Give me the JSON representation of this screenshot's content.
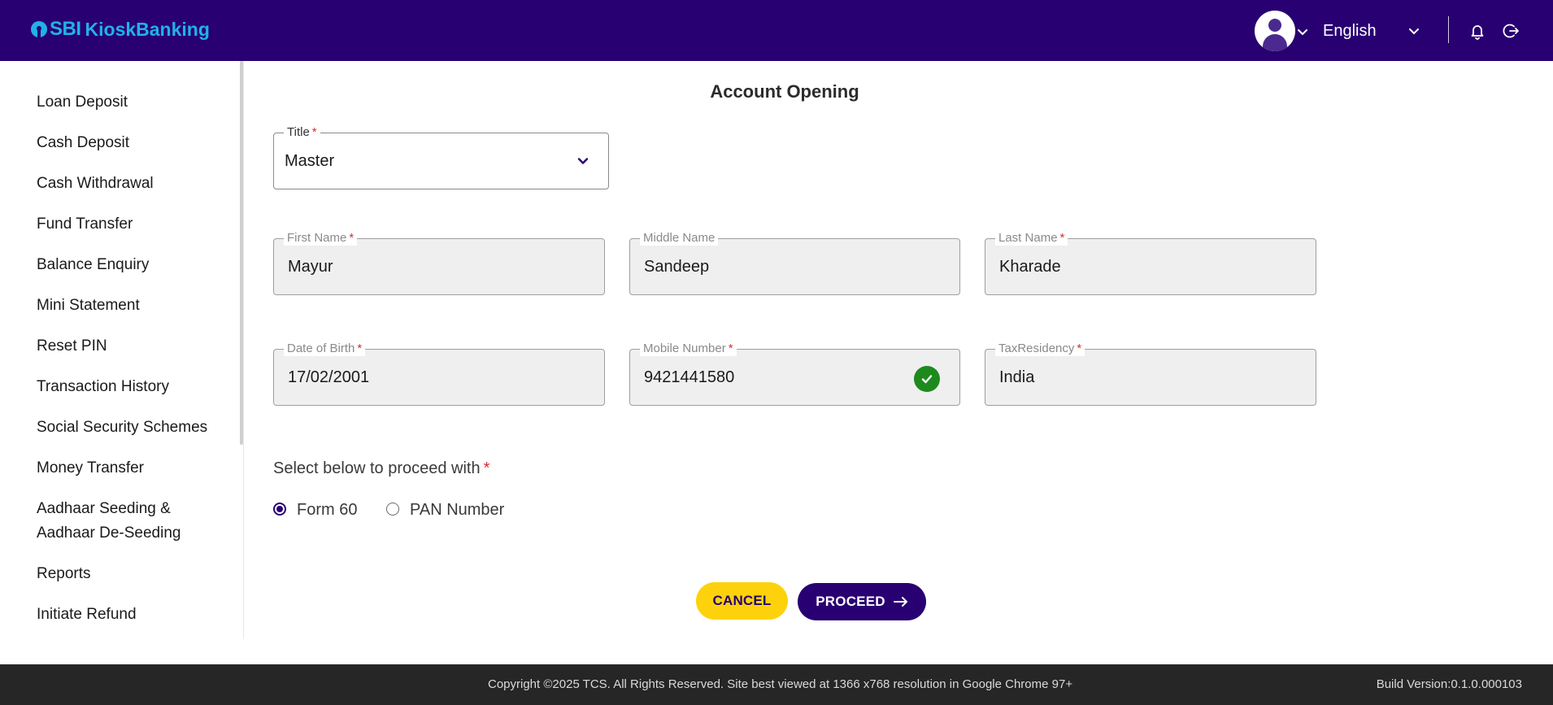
{
  "header": {
    "logo_sbi": "SBI",
    "logo_kiosk": "KioskBanking",
    "language": "English"
  },
  "sidebar": {
    "items": [
      {
        "label": "Loan Deposit"
      },
      {
        "label": "Cash Deposit"
      },
      {
        "label": "Cash Withdrawal"
      },
      {
        "label": "Fund Transfer"
      },
      {
        "label": "Balance Enquiry"
      },
      {
        "label": "Mini Statement"
      },
      {
        "label": "Reset PIN"
      },
      {
        "label": "Transaction History"
      },
      {
        "label": "Social Security Schemes"
      },
      {
        "label": "Money Transfer"
      },
      {
        "label": "Aadhaar Seeding & Aadhaar De-Seeding"
      },
      {
        "label": "Reports"
      },
      {
        "label": "Initiate Refund"
      }
    ]
  },
  "main": {
    "title": "Account Opening",
    "required_marker": "*",
    "fields": {
      "title": {
        "label": "Title",
        "value": "Master"
      },
      "first_name": {
        "label": "First Name",
        "value": "Mayur"
      },
      "middle_name": {
        "label": "Middle Name",
        "value": "Sandeep"
      },
      "last_name": {
        "label": "Last Name",
        "value": "Kharade"
      },
      "dob": {
        "label": "Date of Birth",
        "value": "17/02/2001"
      },
      "mobile": {
        "label": "Mobile Number",
        "value": "9421441580"
      },
      "tax_residency": {
        "label": "TaxResidency",
        "value": "India"
      }
    },
    "proceed_prompt": "Select below to proceed with",
    "options": [
      {
        "label": "Form 60",
        "selected": true
      },
      {
        "label": "PAN Number",
        "selected": false
      }
    ],
    "cancel_label": "CANCEL",
    "proceed_label": "PROCEED"
  },
  "footer": {
    "copyright": "Copyright ©2025 TCS. All Rights Reserved. Site best viewed at 1366 x768 resolution in Google Chrome 97+",
    "build": "Build Version:0.1.0.000103"
  },
  "colors": {
    "brand": "#280071",
    "accent": "#fdd20c",
    "success": "#1e8a1e",
    "logo": "#22b1e8"
  },
  "icons": [
    "user-avatar-icon",
    "chevron-down-icon",
    "bell-icon",
    "logout-icon",
    "check-circle-icon",
    "arrow-right-icon"
  ]
}
